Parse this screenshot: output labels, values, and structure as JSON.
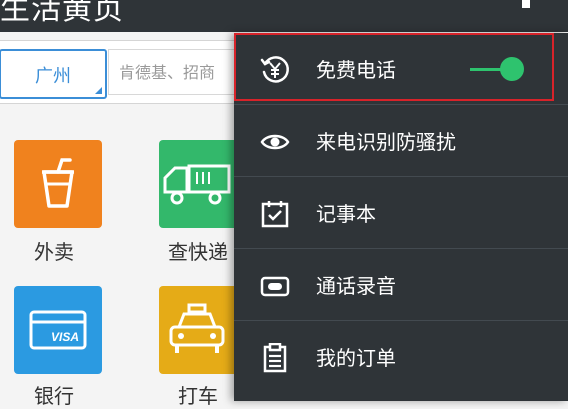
{
  "header": {
    "title": "生活黄页"
  },
  "search": {
    "city": "广州",
    "placeholder": "肯德基、招商"
  },
  "tiles": [
    {
      "label": "外卖",
      "icon": "cup-icon",
      "color": "#f0821e"
    },
    {
      "label": "查快递",
      "icon": "truck-icon",
      "color": "#33b86b"
    },
    {
      "label": "银行",
      "icon": "card-icon",
      "color": "#2b9ae1"
    },
    {
      "label": "打车",
      "icon": "taxi-icon",
      "color": "#e5ab17"
    }
  ],
  "menu": {
    "items": [
      {
        "label": "免费电话",
        "icon": "yuan-phone-icon",
        "toggle": true
      },
      {
        "label": "来电识别防骚扰",
        "icon": "eye-icon"
      },
      {
        "label": "记事本",
        "icon": "calendar-check-icon"
      },
      {
        "label": "通话录音",
        "icon": "record-icon"
      },
      {
        "label": "我的订单",
        "icon": "clipboard-icon"
      }
    ]
  },
  "colors": {
    "accent": "#3b8ed7",
    "toggle_on": "#2ec36e",
    "highlight": "#d8232a",
    "menu_bg": "#2f3438"
  }
}
